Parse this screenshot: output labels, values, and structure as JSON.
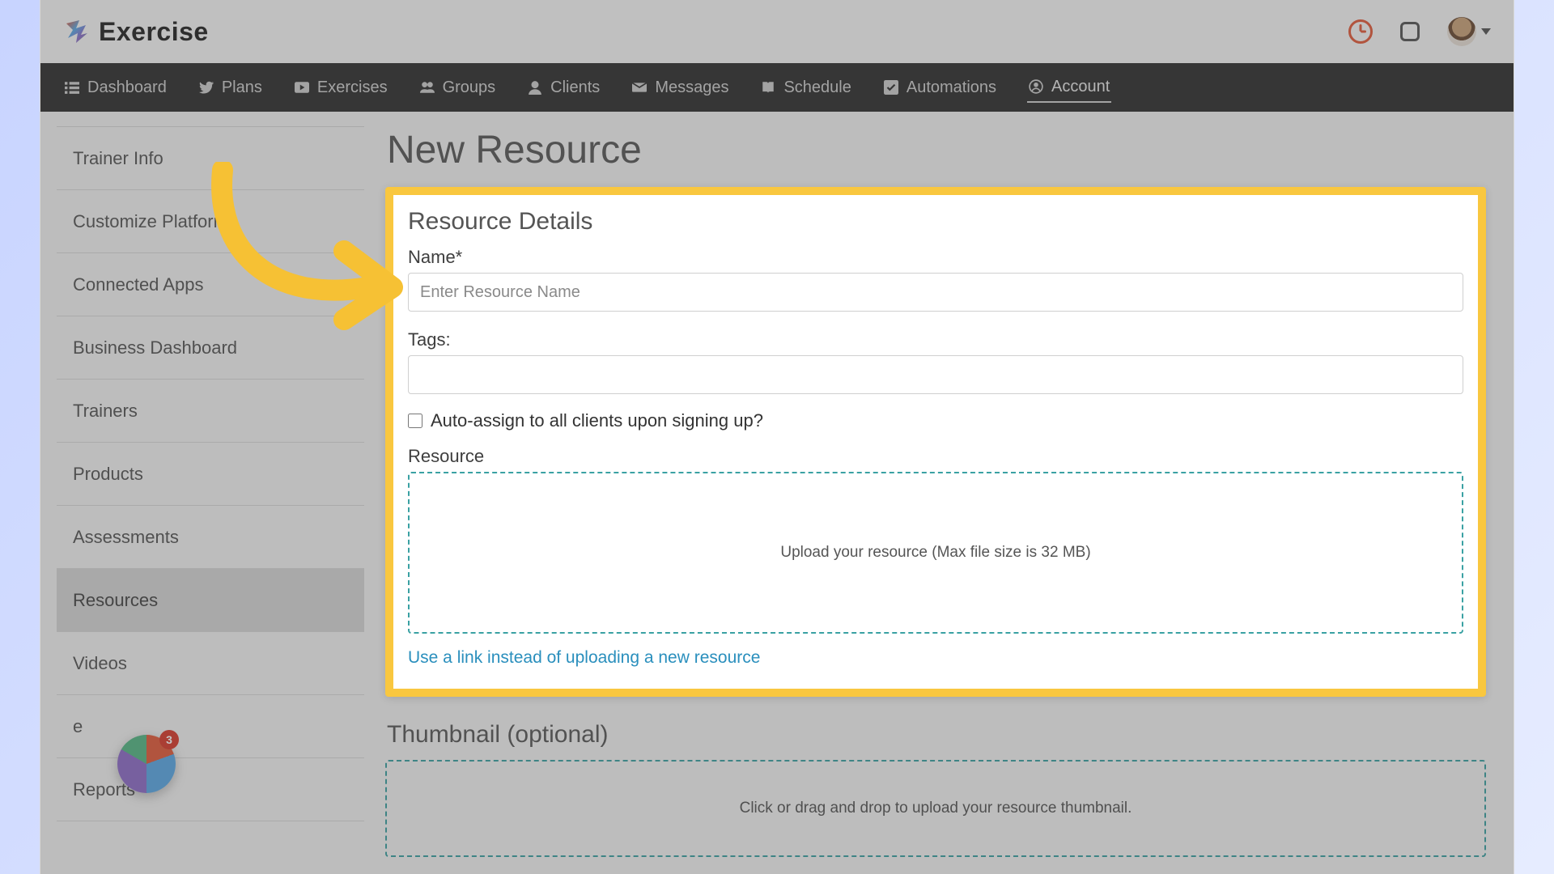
{
  "brand": "Exercise",
  "topbar": {
    "clock_name": "clock",
    "square_name": "checkbox",
    "badge_count": "3"
  },
  "nav": {
    "items": [
      {
        "label": "Dashboard",
        "icon": "list"
      },
      {
        "label": "Plans",
        "icon": "bird"
      },
      {
        "label": "Exercises",
        "icon": "play"
      },
      {
        "label": "Groups",
        "icon": "people"
      },
      {
        "label": "Clients",
        "icon": "person"
      },
      {
        "label": "Messages",
        "icon": "mail"
      },
      {
        "label": "Schedule",
        "icon": "book"
      },
      {
        "label": "Automations",
        "icon": "check"
      },
      {
        "label": "Account",
        "icon": "user",
        "active": true
      }
    ]
  },
  "sidebar": {
    "items": [
      {
        "label": "Trainer Info"
      },
      {
        "label": "Customize Platform"
      },
      {
        "label": "Connected Apps"
      },
      {
        "label": "Business Dashboard"
      },
      {
        "label": "Trainers"
      },
      {
        "label": "Products"
      },
      {
        "label": "Assessments"
      },
      {
        "label": "Resources",
        "selected": true
      },
      {
        "label": "Videos"
      },
      {
        "label": "e"
      },
      {
        "label": "Reports"
      }
    ]
  },
  "page": {
    "title": "New Resource",
    "section_title": "Resource Details",
    "name_label": "Name*",
    "name_placeholder": "Enter Resource Name",
    "tags_label": "Tags:",
    "auto_assign_label": "Auto-assign to all clients upon signing up?",
    "resource_label": "Resource",
    "dropzone_text": "Upload your resource (Max file size is 32 MB)",
    "link_text": "Use a link instead of uploading a new resource",
    "thumb_title": "Thumbnail (optional)",
    "thumb_drop_text": "Click or drag and drop to upload your resource thumbnail."
  }
}
